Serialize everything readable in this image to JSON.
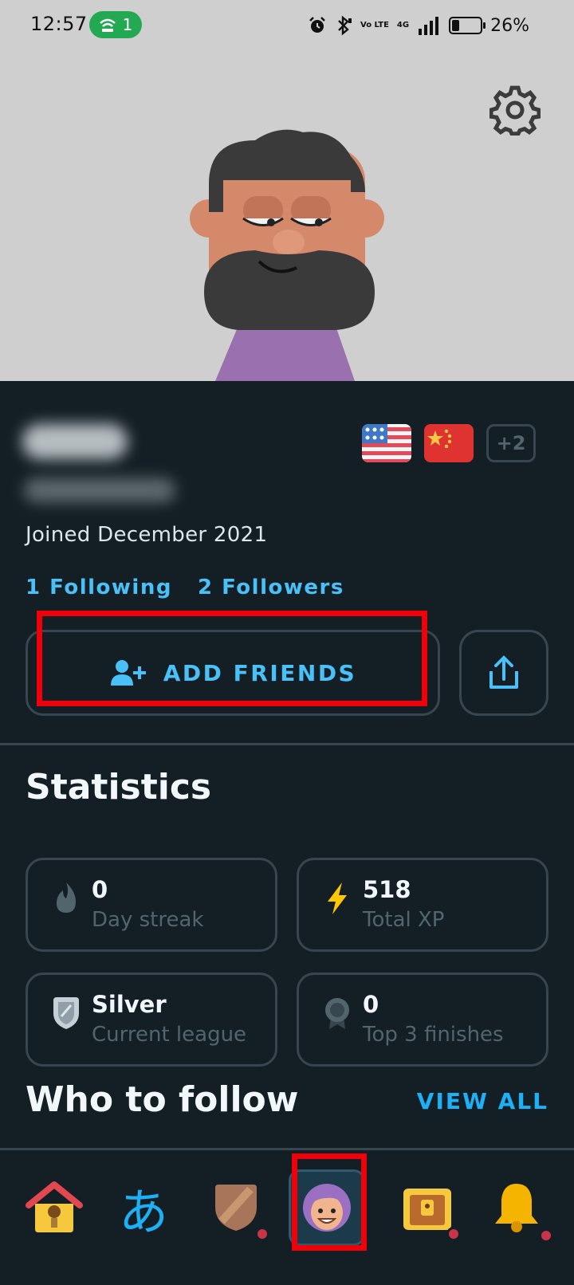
{
  "status_bar": {
    "time": "12:57",
    "hotspot_count": "1",
    "network_label": "Vo LTE",
    "signal_label": "4G",
    "battery_percent_text": "26%",
    "battery_level": 0.26
  },
  "profile": {
    "joined": "Joined December 2021",
    "following": "1 Following",
    "followers": "2 Followers",
    "more_languages": "+2",
    "add_friends_label": "ADD FRIENDS"
  },
  "statistics": {
    "title": "Statistics",
    "items": [
      {
        "value": "0",
        "label": "Day streak",
        "icon": "flame-icon"
      },
      {
        "value": "518",
        "label": "Total XP",
        "icon": "lightning-icon"
      },
      {
        "value": "Silver",
        "label": "Current league",
        "icon": "shield-icon"
      },
      {
        "value": "0",
        "label": "Top 3 finishes",
        "icon": "medal-icon"
      }
    ]
  },
  "who_to_follow": {
    "title": "Who to follow",
    "view_all": "VIEW ALL"
  },
  "nav": {
    "characters_glyph": "あ",
    "items": [
      "home-icon",
      "characters-icon",
      "shield-league-icon",
      "profile-avatar-icon",
      "treasure-chest-icon",
      "bell-icon"
    ]
  },
  "colors": {
    "background": "#131f24",
    "accent_blue": "#1cb0f6",
    "border": "#37464f",
    "highlight_red": "#f00009"
  }
}
